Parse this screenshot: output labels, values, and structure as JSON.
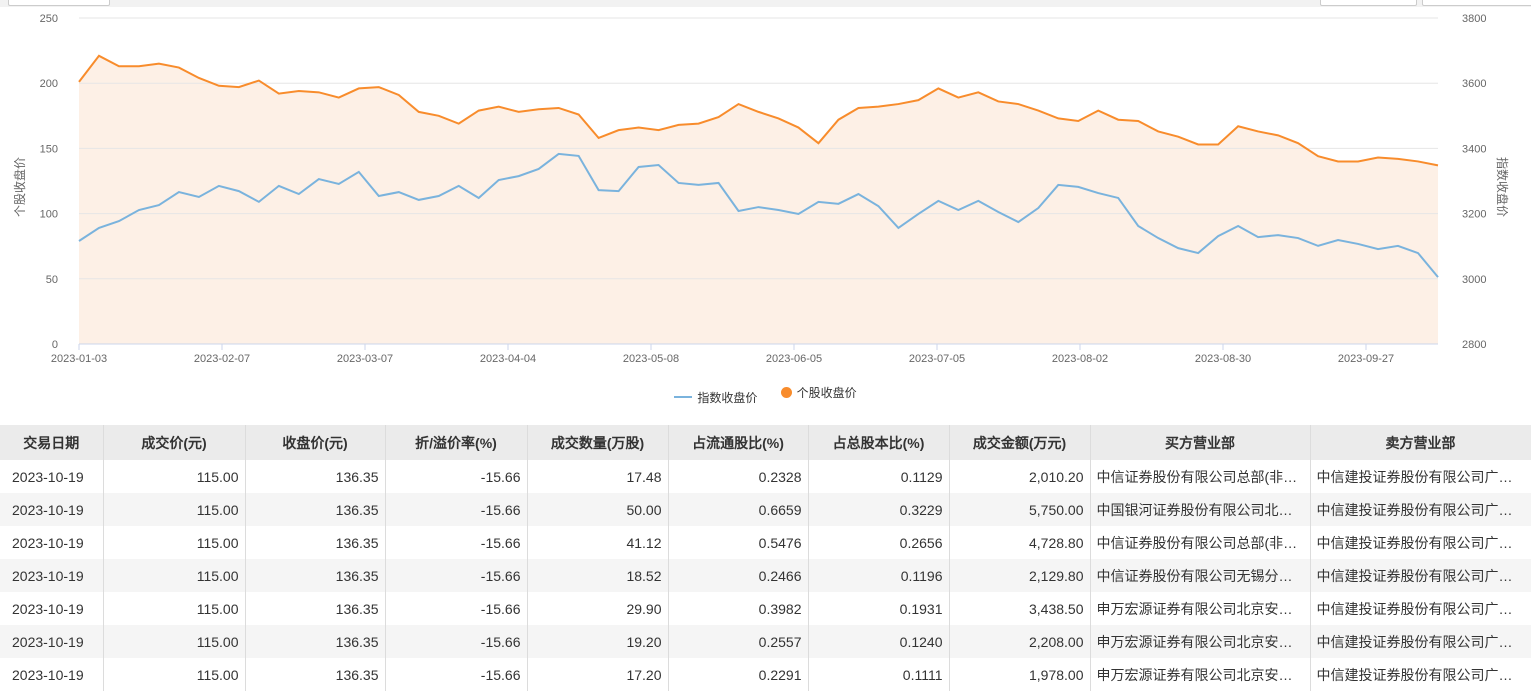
{
  "legend": {
    "index": "指数收盘价",
    "stock": "个股收盘价"
  },
  "colors": {
    "index": "#7ab3dd",
    "stock": "#f88c2c",
    "area": "#fdf0e6"
  },
  "chart_data": {
    "type": "line",
    "left_axis": {
      "label": "个股收盘价",
      "range": [
        0,
        250
      ],
      "ticks": [
        "0",
        "50",
        "100",
        "150",
        "200",
        "250"
      ]
    },
    "right_axis": {
      "label": "指数收盘价",
      "range": [
        2800,
        3800
      ],
      "ticks": [
        "2800",
        "3000",
        "3200",
        "3400",
        "3600",
        "3800"
      ]
    },
    "x_ticks": [
      "2023-01-03",
      "2023-02-07",
      "2023-03-07",
      "2023-04-04",
      "2023-05-08",
      "2023-06-05",
      "2023-07-05",
      "2023-08-02",
      "2023-08-30",
      "2023-09-27"
    ],
    "series": [
      {
        "name": "个股收盘价",
        "axis": "left",
        "values": [
          201,
          221,
          213,
          213,
          215,
          212,
          204,
          198,
          197,
          202,
          192,
          194,
          193,
          189,
          196,
          197,
          191,
          178,
          175,
          169,
          179,
          182,
          178,
          180,
          181,
          176,
          158,
          164,
          166,
          164,
          168,
          169,
          174,
          184,
          178,
          173,
          166,
          154,
          172,
          181,
          182,
          184,
          187,
          196,
          189,
          193,
          186,
          184,
          179,
          173,
          171,
          179,
          172,
          171,
          163,
          159,
          153,
          153,
          167,
          163,
          160,
          154,
          144,
          140,
          140,
          143,
          142,
          140,
          137
        ]
      },
      {
        "name": "指数收盘价",
        "axis": "right",
        "values": [
          3116,
          3156,
          3177,
          3211,
          3226,
          3266,
          3251,
          3285,
          3269,
          3236,
          3285,
          3260,
          3306,
          3291,
          3328,
          3254,
          3266,
          3242,
          3254,
          3285,
          3248,
          3303,
          3315,
          3337,
          3383,
          3377,
          3272,
          3269,
          3343,
          3349,
          3294,
          3288,
          3294,
          3208,
          3220,
          3211,
          3199,
          3236,
          3230,
          3260,
          3223,
          3156,
          3199,
          3239,
          3211,
          3239,
          3205,
          3174,
          3217,
          3288,
          3282,
          3263,
          3248,
          3162,
          3125,
          3094,
          3079,
          3131,
          3162,
          3128,
          3134,
          3125,
          3101,
          3119,
          3107,
          3091,
          3101,
          3079,
          3005
        ]
      }
    ]
  },
  "table": {
    "headers": [
      "交易日期",
      "成交价(元)",
      "收盘价(元)",
      "折/溢价率(%)",
      "成交数量(万股)",
      "占流通股比(%)",
      "占总股本比(%)",
      "成交金额(万元)",
      "买方营业部",
      "卖方营业部"
    ],
    "rows": [
      [
        "2023-10-19",
        "115.00",
        "136.35",
        "-15.66",
        "17.48",
        "0.2328",
        "0.1129",
        "2,010.20",
        "中信证券股份有限公司总部(非…",
        "中信建投证券股份有限公司广…"
      ],
      [
        "2023-10-19",
        "115.00",
        "136.35",
        "-15.66",
        "50.00",
        "0.6659",
        "0.3229",
        "5,750.00",
        "中国银河证券股份有限公司北…",
        "中信建投证券股份有限公司广…"
      ],
      [
        "2023-10-19",
        "115.00",
        "136.35",
        "-15.66",
        "41.12",
        "0.5476",
        "0.2656",
        "4,728.80",
        "中信证券股份有限公司总部(非…",
        "中信建投证券股份有限公司广…"
      ],
      [
        "2023-10-19",
        "115.00",
        "136.35",
        "-15.66",
        "18.52",
        "0.2466",
        "0.1196",
        "2,129.80",
        "中信证券股份有限公司无锡分…",
        "中信建投证券股份有限公司广…"
      ],
      [
        "2023-10-19",
        "115.00",
        "136.35",
        "-15.66",
        "29.90",
        "0.3982",
        "0.1931",
        "3,438.50",
        "申万宏源证券有限公司北京安…",
        "中信建投证券股份有限公司广…"
      ],
      [
        "2023-10-19",
        "115.00",
        "136.35",
        "-15.66",
        "19.20",
        "0.2557",
        "0.1240",
        "2,208.00",
        "申万宏源证券有限公司北京安…",
        "中信建投证券股份有限公司广…"
      ],
      [
        "2023-10-19",
        "115.00",
        "136.35",
        "-15.66",
        "17.20",
        "0.2291",
        "0.1111",
        "1,978.00",
        "申万宏源证券有限公司北京安…",
        "中信建投证券股份有限公司广…"
      ]
    ]
  }
}
